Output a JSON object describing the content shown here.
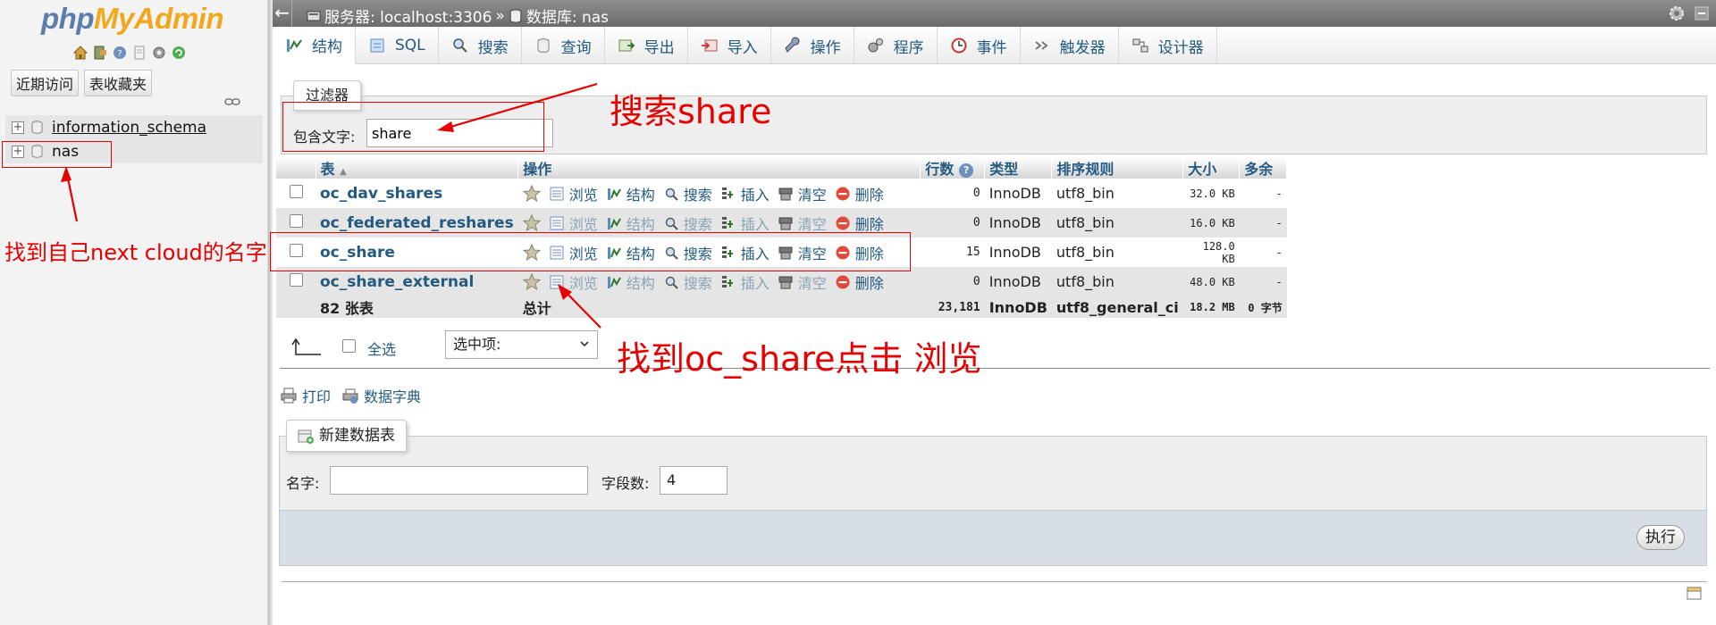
{
  "app": {
    "logo_part1": "php",
    "logo_part2": "MyAdmin"
  },
  "nav": {
    "buttons": [
      "近期访问",
      "表收藏夹"
    ],
    "databases": [
      {
        "name": "information_schema"
      },
      {
        "name": "nas"
      }
    ]
  },
  "topbar": {
    "server": "服务器: localhost:3306",
    "separator": "»",
    "database": "数据库: nas"
  },
  "tabs": [
    {
      "label": "结构",
      "icon": "structure-icon",
      "active": true
    },
    {
      "label": "SQL",
      "icon": "sql-icon"
    },
    {
      "label": "搜索",
      "icon": "search-icon"
    },
    {
      "label": "查询",
      "icon": "query-icon"
    },
    {
      "label": "导出",
      "icon": "export-icon"
    },
    {
      "label": "导入",
      "icon": "import-icon"
    },
    {
      "label": "操作",
      "icon": "wrench-icon"
    },
    {
      "label": "程序",
      "icon": "routines-icon"
    },
    {
      "label": "事件",
      "icon": "clock-icon"
    },
    {
      "label": "触发器",
      "icon": "trigger-icon"
    },
    {
      "label": "设计器",
      "icon": "designer-icon"
    }
  ],
  "filter": {
    "legend": "过滤器",
    "label": "包含文字:",
    "value": "share"
  },
  "table_list": {
    "headers": {
      "table": "表",
      "action": "操作",
      "rows": "行数",
      "type": "类型",
      "collation": "排序规则",
      "size": "大小",
      "overhead": "多余"
    },
    "actions": [
      "浏览",
      "结构",
      "搜索",
      "插入",
      "清空",
      "删除"
    ],
    "rows": [
      {
        "name": "oc_dav_shares",
        "rows": "0",
        "type": "InnoDB",
        "collation": "utf8_bin",
        "size": "32.0 KB",
        "overhead": "-",
        "dim": false
      },
      {
        "name": "oc_federated_reshares",
        "rows": "0",
        "type": "InnoDB",
        "collation": "utf8_bin",
        "size": "16.0 KB",
        "overhead": "-",
        "dim": true
      },
      {
        "name": "oc_share",
        "rows": "15",
        "type": "InnoDB",
        "collation": "utf8_bin",
        "size": "128.0 KB",
        "overhead": "-",
        "dim": false
      },
      {
        "name": "oc_share_external",
        "rows": "0",
        "type": "InnoDB",
        "collation": "utf8_bin",
        "size": "48.0 KB",
        "overhead": "-",
        "dim": true
      }
    ],
    "footer": {
      "count": "82 张表",
      "label": "总计",
      "rows": "23,181",
      "type": "InnoDB",
      "collation": "utf8_general_ci",
      "size": "18.2 MB",
      "overhead": "0 字节"
    }
  },
  "bulk": {
    "select_all": "全选",
    "with_selected": "选中项:"
  },
  "links": {
    "print": "打印",
    "data_dictionary": "数据字典"
  },
  "new_table": {
    "legend": "新建数据表",
    "name_label": "名字:",
    "name_value": "",
    "columns_label": "字段数:",
    "columns_value": "4",
    "go": "执行"
  },
  "annotations": {
    "search": "搜索share",
    "find_db": "找到自己next cloud的名字",
    "find_table": "找到oc_share点击 浏览"
  },
  "colors": {
    "link": "#235a81",
    "annotation": "#e60000",
    "logo_php": "#5c7cb0",
    "logo_myadmin": "#f2a71c"
  }
}
